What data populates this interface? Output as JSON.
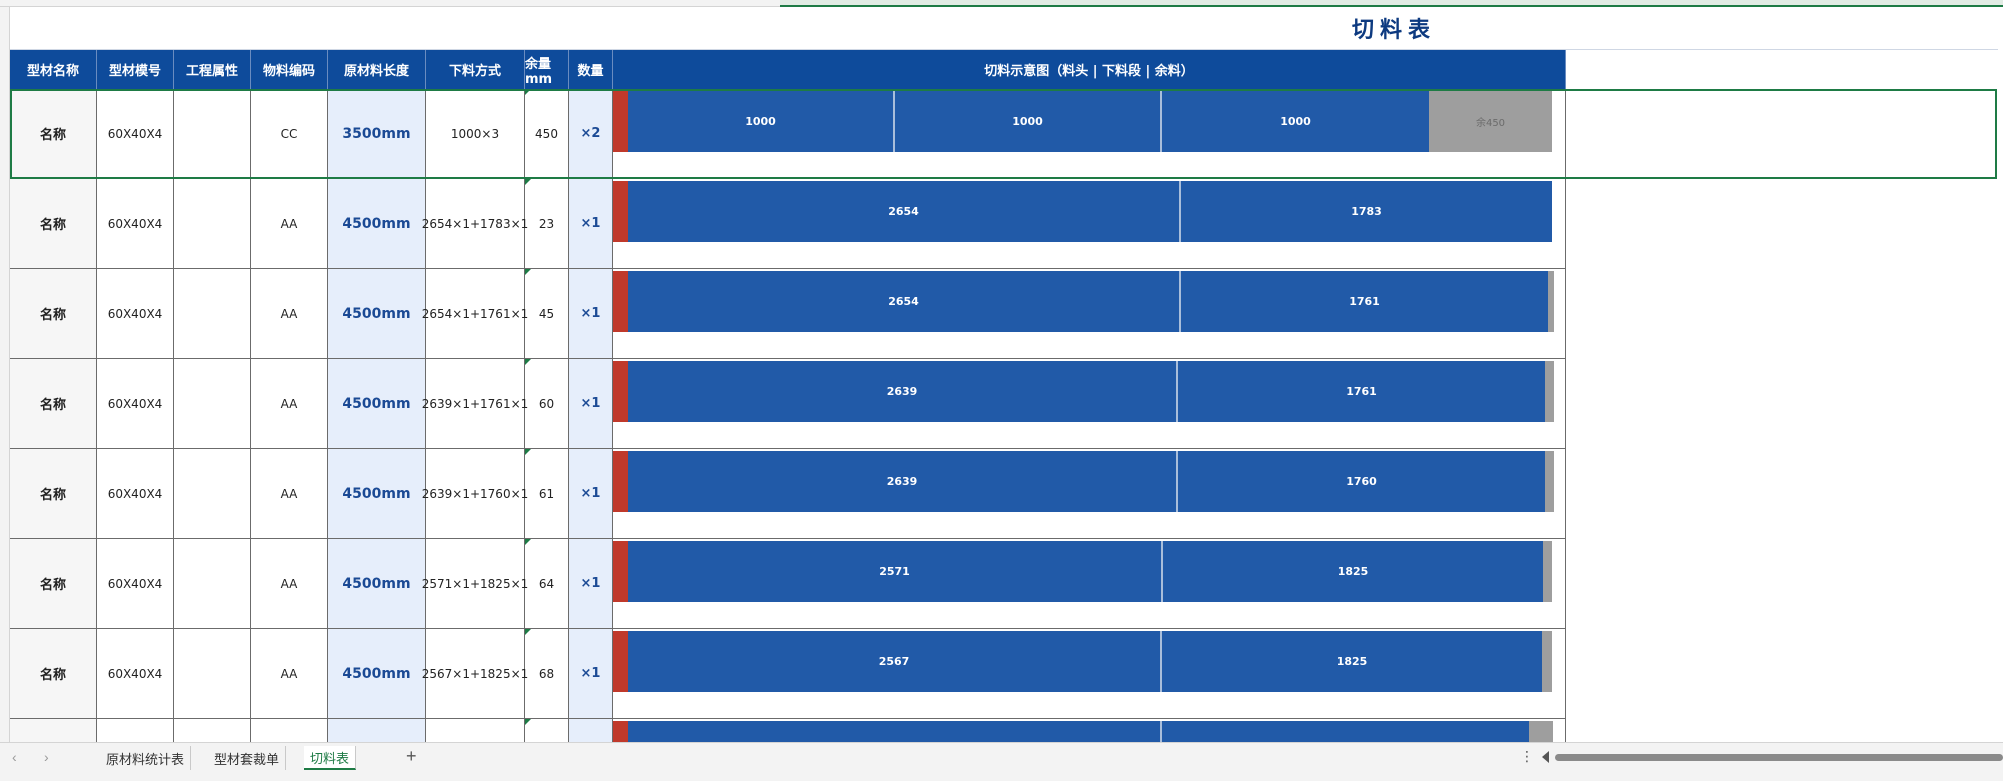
{
  "title": "切料表",
  "headers": [
    "型材名称",
    "型材模号",
    "工程属性",
    "物料编码",
    "原材料长度",
    "下料方式",
    "余量mm",
    "数量",
    "切料示意图（料头 | 下料段 | 余料）"
  ],
  "rows": [
    {
      "name": "名称",
      "model": "60X40X4",
      "project": "",
      "code": "CC",
      "length": "3500mm",
      "method": "1000×3",
      "remain": "450",
      "qty": "×2",
      "segments": [
        "1000",
        "1000",
        "1000"
      ],
      "remainder_label": "余450"
    },
    {
      "name": "名称",
      "model": "60X40X4",
      "project": "",
      "code": "AA",
      "length": "4500mm",
      "method": "2654×1+1783×1",
      "remain": "23",
      "qty": "×1",
      "segments": [
        "2654",
        "1783"
      ],
      "remainder_label": ""
    },
    {
      "name": "名称",
      "model": "60X40X4",
      "project": "",
      "code": "AA",
      "length": "4500mm",
      "method": "2654×1+1761×1",
      "remain": "45",
      "qty": "×1",
      "segments": [
        "2654",
        "1761"
      ],
      "remainder_label": ""
    },
    {
      "name": "名称",
      "model": "60X40X4",
      "project": "",
      "code": "AA",
      "length": "4500mm",
      "method": "2639×1+1761×1",
      "remain": "60",
      "qty": "×1",
      "segments": [
        "2639",
        "1761"
      ],
      "remainder_label": ""
    },
    {
      "name": "名称",
      "model": "60X40X4",
      "project": "",
      "code": "AA",
      "length": "4500mm",
      "method": "2639×1+1760×1",
      "remain": "61",
      "qty": "×1",
      "segments": [
        "2639",
        "1760"
      ],
      "remainder_label": ""
    },
    {
      "name": "名称",
      "model": "60X40X4",
      "project": "",
      "code": "AA",
      "length": "4500mm",
      "method": "2571×1+1825×1",
      "remain": "64",
      "qty": "×1",
      "segments": [
        "2571",
        "1825"
      ],
      "remainder_label": ""
    },
    {
      "name": "名称",
      "model": "60X40X4",
      "project": "",
      "code": "AA",
      "length": "4500mm",
      "method": "2567×1+1825×1",
      "remain": "68",
      "qty": "×1",
      "segments": [
        "2567",
        "1825"
      ],
      "remainder_label": ""
    },
    {
      "name": "",
      "model": "",
      "project": "",
      "code": "",
      "length": "",
      "method": "",
      "remain": "",
      "qty": "",
      "segments": [
        "",
        ""
      ],
      "remainder_label": ""
    }
  ],
  "sheet_tabs": [
    "原材料统计表",
    "型材套裁单",
    "切料表"
  ],
  "active_tab": "切料表",
  "add_tab_label": "+",
  "more_label": "⋮",
  "colors": {
    "header_bg": "#0e4b9b",
    "segment": "#215aa8",
    "head_cut": "#c0392b",
    "remainder": "#9e9e9e",
    "accent": "#1e7b45",
    "title": "#0d3a80"
  }
}
